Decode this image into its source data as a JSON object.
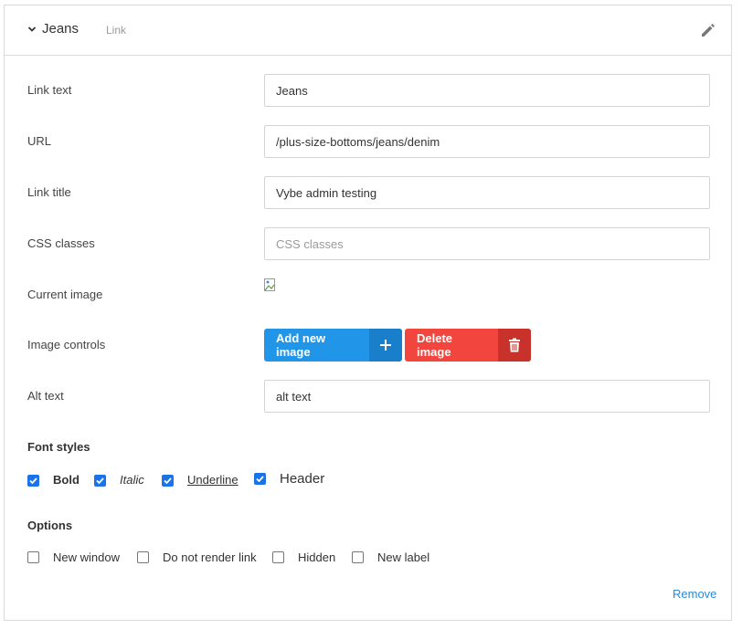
{
  "header": {
    "title": "Jeans",
    "subtitle": "Link"
  },
  "fields": {
    "link_text": {
      "label": "Link text",
      "value": "Jeans"
    },
    "url": {
      "label": "URL",
      "value": "/plus-size-bottoms/jeans/denim"
    },
    "link_title": {
      "label": "Link title",
      "value": "Vybe admin testing"
    },
    "css_classes": {
      "label": "CSS classes",
      "value": "",
      "placeholder": "CSS classes"
    },
    "current_image": {
      "label": "Current image"
    },
    "image_controls": {
      "label": "Image controls",
      "add_label": "Add new image",
      "delete_label": "Delete image"
    },
    "alt_text": {
      "label": "Alt text",
      "value": "alt text"
    }
  },
  "font_styles": {
    "title": "Font styles",
    "items": [
      {
        "label": "Bold",
        "checked": true
      },
      {
        "label": "Italic",
        "checked": true
      },
      {
        "label": "Underline",
        "checked": true
      },
      {
        "label": "Header",
        "checked": true
      }
    ]
  },
  "options": {
    "title": "Options",
    "items": [
      {
        "label": "New window",
        "checked": false
      },
      {
        "label": "Do not render link",
        "checked": false
      },
      {
        "label": "Hidden",
        "checked": false
      },
      {
        "label": "New label",
        "checked": false
      }
    ]
  },
  "footer": {
    "remove_label": "Remove"
  },
  "colors": {
    "primary": "#2196e8",
    "danger": "#f1453d",
    "checkbox": "#1a73e8",
    "link": "#2a8ad4"
  }
}
